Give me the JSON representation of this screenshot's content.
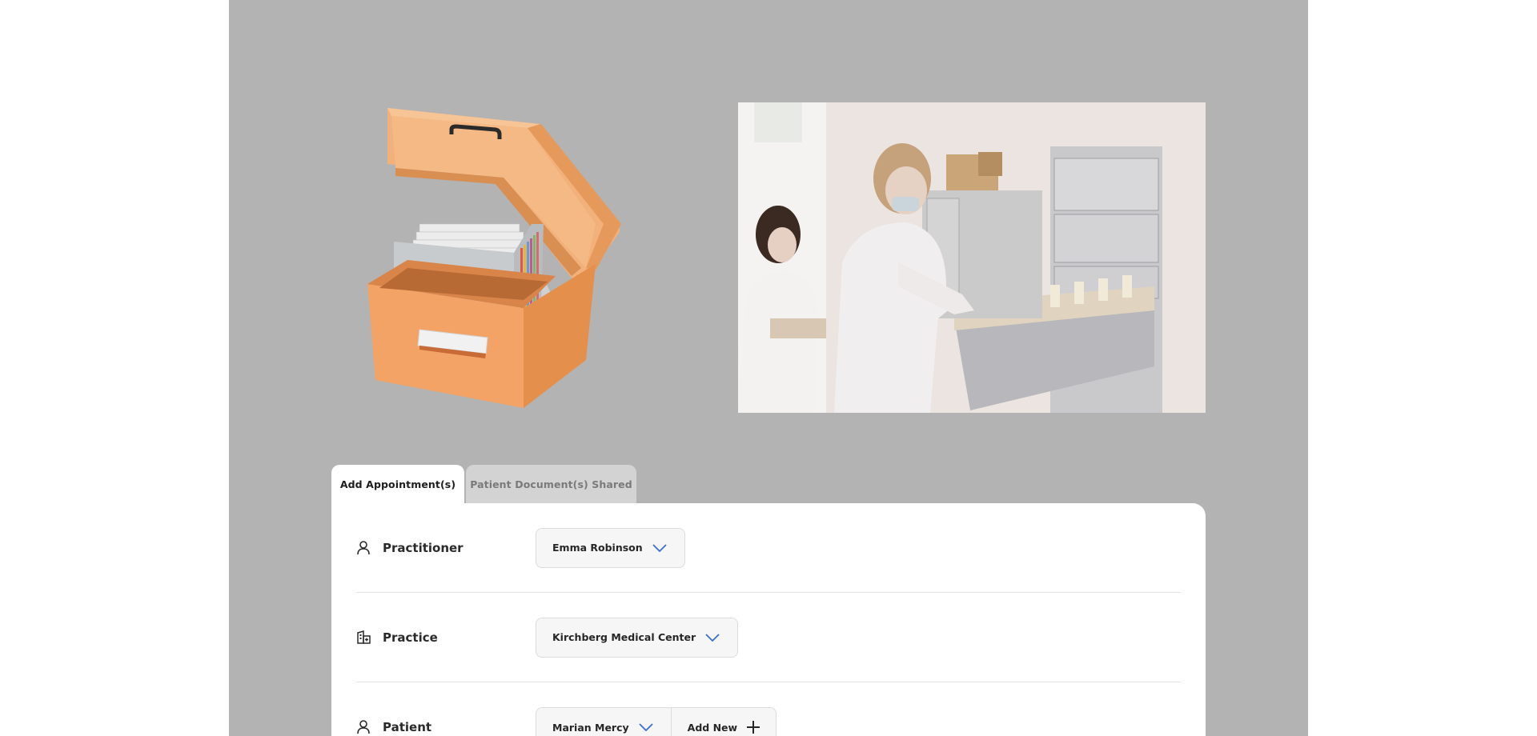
{
  "tabs": [
    {
      "label": "Add Appointment(s)",
      "active": true
    },
    {
      "label": "Patient Document(s) Shared",
      "active": false
    }
  ],
  "form": {
    "practitioner": {
      "label": "Practitioner",
      "icon": "person-icon",
      "value": "Emma Robinson"
    },
    "practice": {
      "label": "Practice",
      "icon": "building-icon",
      "value": "Kirchberg Medical Center"
    },
    "patient": {
      "label": "Patient",
      "icon": "person-icon",
      "value": "Marian Mercy",
      "add_label": "Add New"
    }
  },
  "colors": {
    "accent": "#3a6fd8",
    "backdrop": "#b3b3b3"
  }
}
